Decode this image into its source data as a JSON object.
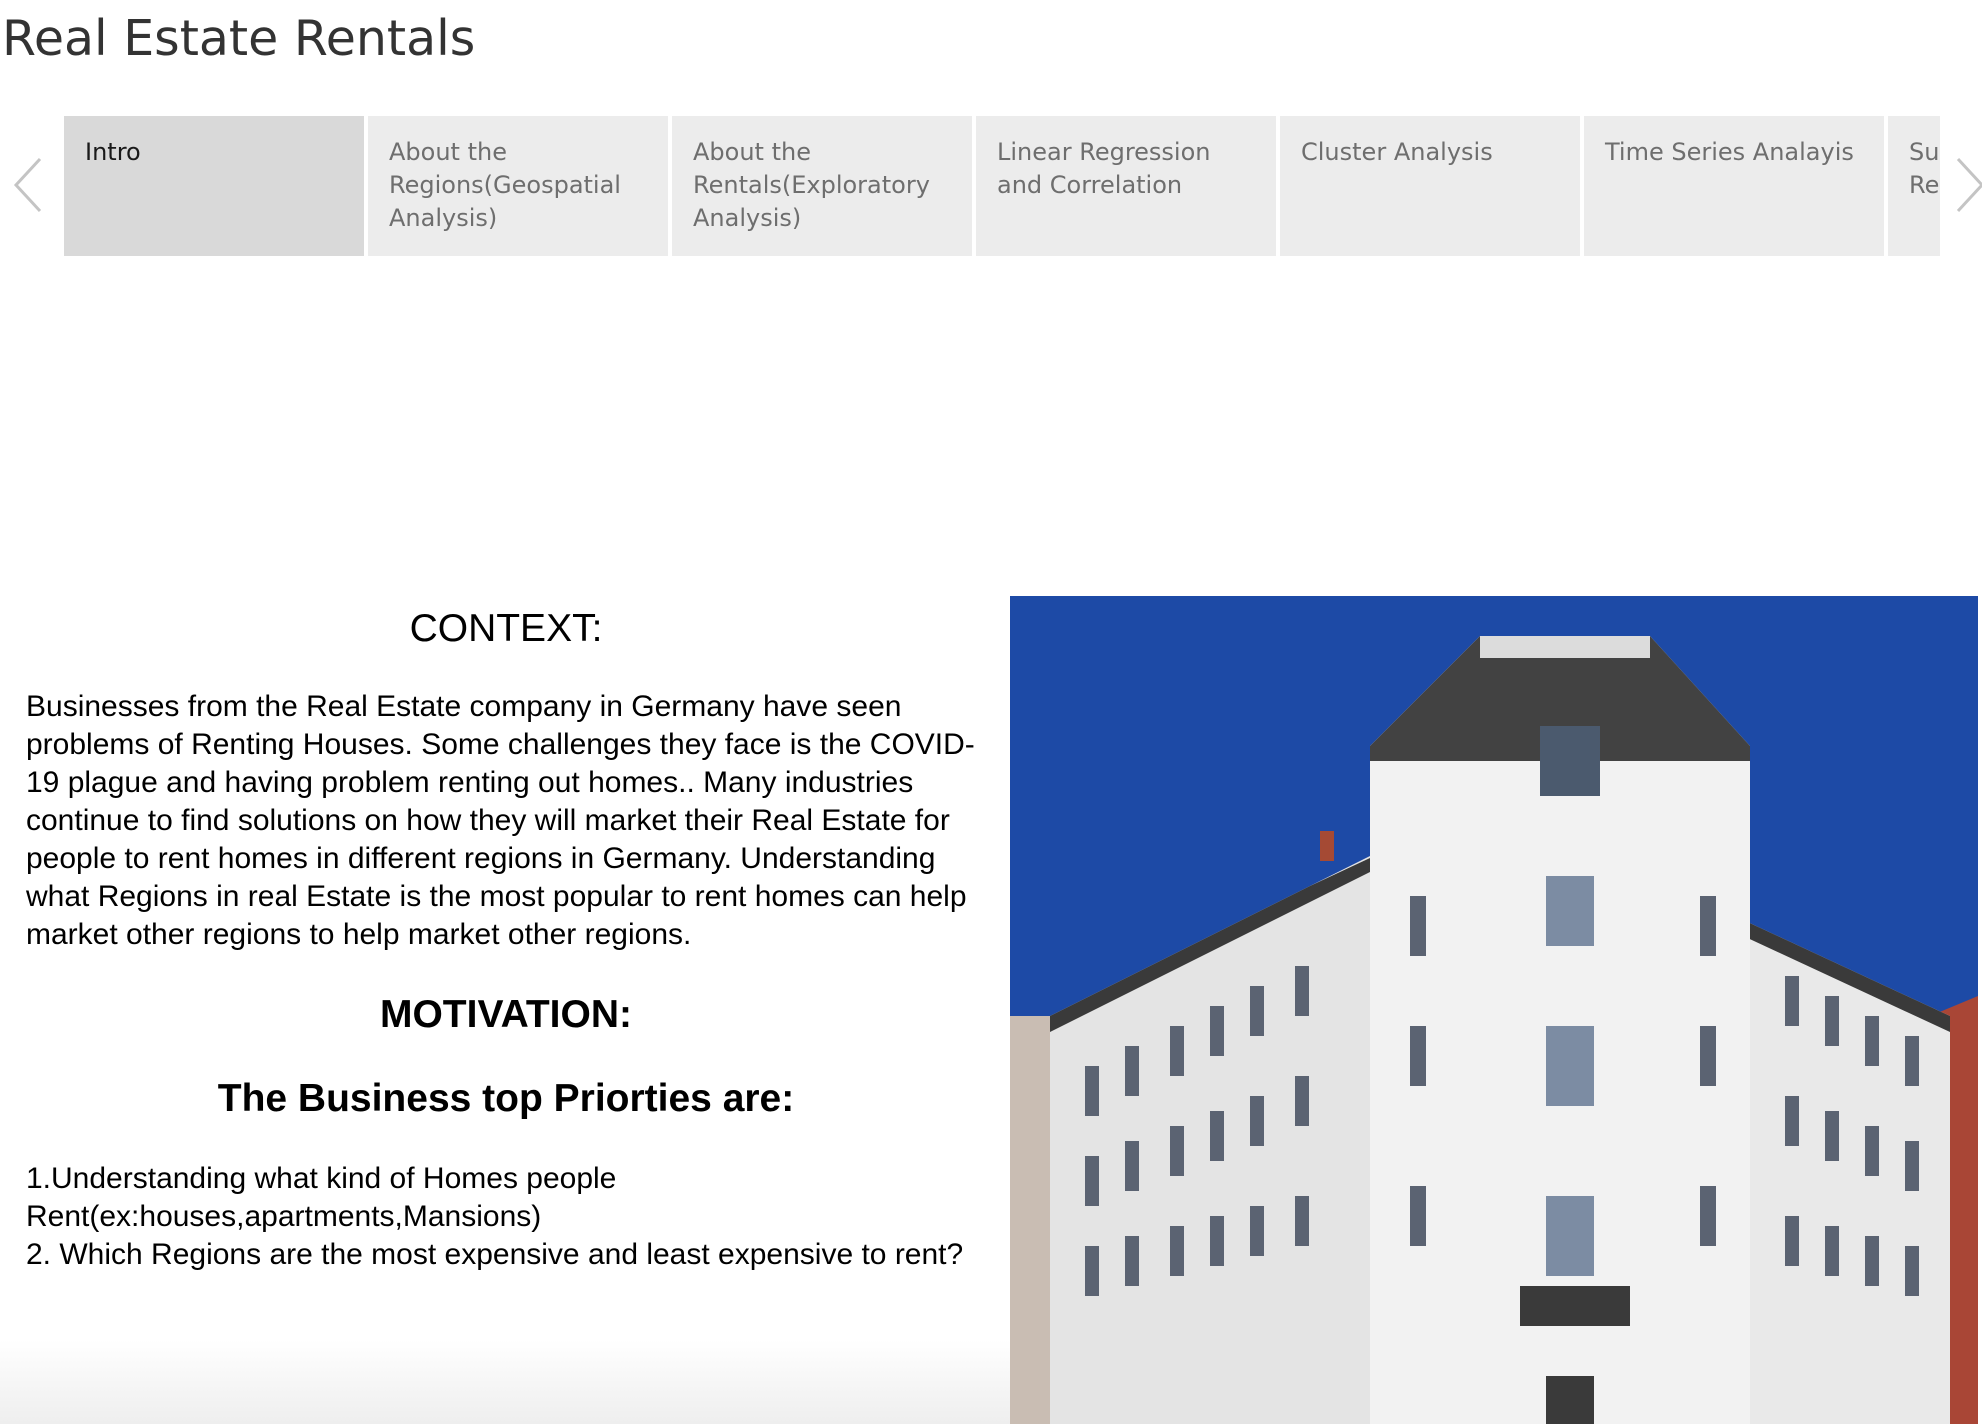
{
  "header": {
    "title": "Real Estate Rentals"
  },
  "nav": {
    "prev_icon": "chevron-left-icon",
    "next_icon": "chevron-right-icon"
  },
  "tabs": [
    {
      "label": "Intro",
      "active": true
    },
    {
      "label": "About the Regions(Geospatial Analysis)",
      "active": false
    },
    {
      "label": "About the Rentals(Exploratory Analysis)",
      "active": false
    },
    {
      "label": "Linear Regression and Correlation",
      "active": false
    },
    {
      "label": "Cluster Analysis",
      "active": false
    },
    {
      "label": "Time Series Analayis",
      "active": false
    },
    {
      "label": "Summary and Recommendations",
      "active": false
    }
  ],
  "content": {
    "context_heading": "CONTEXT:",
    "context_text": "Businesses from the Real Estate company in Germany have seen problems of Renting Houses. Some challenges they face is the COVID-19 plague and having problem renting out homes.. Many industries continue to find solutions on how they will market their Real Estate for people to rent homes in different regions in Germany. Understanding what Regions in real Estate is the most popular to rent homes can help market other regions to help market other regions.",
    "motivation_heading": "MOTIVATION:",
    "priorities_heading": "The Business top Priorties are:",
    "priorities": [
      "1.Understanding what kind of Homes people Rent(ex:houses,apartments,Mansions)",
      "2. Which Regions are the most expensive and least expensive to rent?"
    ]
  },
  "image": {
    "subject": "building-photo",
    "sky_color": "#1a48a8",
    "facade_color": "#eeeeee",
    "brick_color": "#b5473a"
  }
}
